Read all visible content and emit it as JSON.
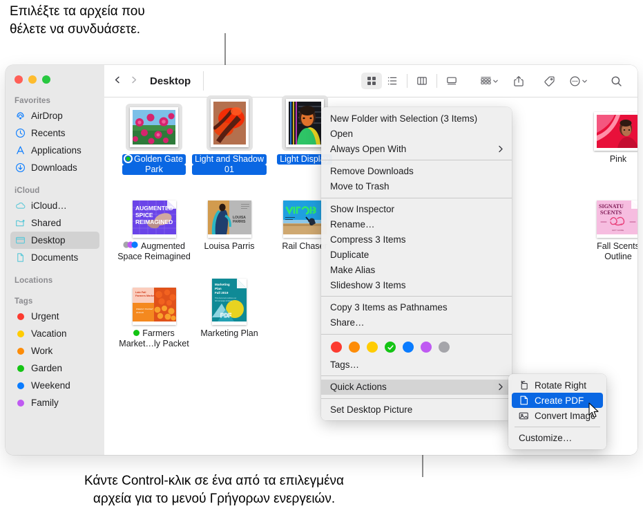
{
  "captions": {
    "top": "Επιλέξτε τα αρχεία που\nθέλετε να συνδυάσετε.",
    "bottom": "Κάντε Control-κλικ σε ένα από τα επιλεγμένα\nαρχεία για το μενού Γρήγορων ενεργειών."
  },
  "window": {
    "traffic_lights": [
      {
        "name": "close",
        "color": "#ff5f57"
      },
      {
        "name": "minimize",
        "color": "#febc2e"
      },
      {
        "name": "zoom",
        "color": "#28c840"
      }
    ]
  },
  "toolbar": {
    "back_icon": "chevron-left-icon",
    "forward_icon": "chevron-right-icon",
    "title": "Desktop",
    "views": [
      {
        "name": "icon-view",
        "icon": "grid-icon",
        "active": true
      },
      {
        "name": "list-view",
        "icon": "list-icon",
        "active": false
      },
      {
        "name": "column-view",
        "icon": "columns-icon",
        "active": false
      },
      {
        "name": "gallery-view",
        "icon": "gallery-icon",
        "active": false
      }
    ],
    "group_by_label": "group-icon",
    "share_label": "share-icon",
    "tag_label": "tag-icon",
    "more_label": "more-icon",
    "search_label": "search-icon"
  },
  "sidebar": {
    "sections": [
      {
        "header": "Favorites",
        "items": [
          {
            "label": "AirDrop",
            "icon": "airdrop-icon",
            "selected": false
          },
          {
            "label": "Recents",
            "icon": "clock-icon",
            "selected": false
          },
          {
            "label": "Applications",
            "icon": "applications-icon",
            "selected": false
          },
          {
            "label": "Downloads",
            "icon": "downloads-icon",
            "selected": false
          }
        ]
      },
      {
        "header": "iCloud",
        "items": [
          {
            "label": "iCloud…",
            "icon": "cloud-icon",
            "selected": false
          },
          {
            "label": "Shared",
            "icon": "shared-folder-icon",
            "selected": false
          },
          {
            "label": "Desktop",
            "icon": "desktop-icon",
            "selected": true
          },
          {
            "label": "Documents",
            "icon": "document-icon",
            "selected": false
          }
        ]
      },
      {
        "header": "Locations",
        "items": []
      },
      {
        "header": "Tags",
        "items": [
          {
            "label": "Urgent",
            "icon": "tag-dot",
            "color": "#fc3b30",
            "selected": false
          },
          {
            "label": "Vacation",
            "icon": "tag-dot",
            "color": "#ffcc02",
            "selected": false
          },
          {
            "label": "Work",
            "icon": "tag-dot",
            "color": "#fd8c08",
            "selected": false
          },
          {
            "label": "Garden",
            "icon": "tag-dot",
            "color": "#14c414",
            "selected": false
          },
          {
            "label": "Weekend",
            "icon": "tag-dot",
            "color": "#0a7cff",
            "selected": false
          },
          {
            "label": "Family",
            "icon": "tag-dot",
            "color": "#bf5af2",
            "selected": false
          }
        ]
      }
    ]
  },
  "files": [
    {
      "name_lines": [
        "Golden Gate",
        "Park"
      ],
      "selected": true,
      "tag_color": "#14c414",
      "kind": "photo-flowers"
    },
    {
      "name_lines": [
        "Light and Shadow",
        "01"
      ],
      "selected": true,
      "tag_color": null,
      "kind": "photo-redhand"
    },
    {
      "name_lines": [
        "Light Display"
      ],
      "selected": true,
      "tag_color": null,
      "kind": "photo-portrait"
    },
    {
      "name_lines": [
        "Pink"
      ],
      "selected": false,
      "tag_color": null,
      "kind": "photo-pink"
    },
    {
      "name_lines": [
        "Augmented",
        "Space Reimagined"
      ],
      "selected": false,
      "tag_color": "multi",
      "kind": "doc-augmented"
    },
    {
      "name_lines": [
        "Louisa Parris"
      ],
      "selected": false,
      "tag_color": null,
      "kind": "doc-louisa"
    },
    {
      "name_lines": [
        "Rail Chaser"
      ],
      "selected": false,
      "tag_color": null,
      "kind": "doc-rail"
    },
    {
      "name_lines": [
        "Fall Scents",
        "Outline"
      ],
      "selected": false,
      "tag_color": null,
      "kind": "doc-scents"
    },
    {
      "name_lines": [
        "Farmers",
        "Market…ly Packet"
      ],
      "selected": false,
      "tag_color": "#14c414",
      "kind": "doc-farmers"
    },
    {
      "name_lines": [
        "Marketing Plan"
      ],
      "selected": false,
      "tag_color": null,
      "kind": "doc-marketing"
    }
  ],
  "context_menu": {
    "groups": [
      [
        {
          "label": "New Folder with Selection (3 Items)",
          "submenu": false,
          "highlight": false
        },
        {
          "label": "Open",
          "submenu": false,
          "highlight": false
        },
        {
          "label": "Always Open With",
          "submenu": true,
          "highlight": false
        }
      ],
      [
        {
          "label": "Remove Downloads",
          "submenu": false,
          "highlight": false
        },
        {
          "label": "Move to Trash",
          "submenu": false,
          "highlight": false
        }
      ],
      [
        {
          "label": "Show Inspector",
          "submenu": false,
          "highlight": false
        },
        {
          "label": "Rename…",
          "submenu": false,
          "highlight": false
        },
        {
          "label": "Compress 3 Items",
          "submenu": false,
          "highlight": false
        },
        {
          "label": "Duplicate",
          "submenu": false,
          "highlight": false
        },
        {
          "label": "Make Alias",
          "submenu": false,
          "highlight": false
        },
        {
          "label": "Slideshow 3 Items",
          "submenu": false,
          "highlight": false
        }
      ],
      [
        {
          "label": "Copy 3 Items as Pathnames",
          "submenu": false,
          "highlight": false
        },
        {
          "label": "Share…",
          "submenu": false,
          "highlight": false
        }
      ]
    ],
    "tag_swatches": [
      {
        "name": "red",
        "color": "#fc3b30",
        "checked": false
      },
      {
        "name": "orange",
        "color": "#fd8c08",
        "checked": false
      },
      {
        "name": "yellow",
        "color": "#ffcc02",
        "checked": false
      },
      {
        "name": "green",
        "color": "#14c414",
        "checked": true
      },
      {
        "name": "blue",
        "color": "#0a7cff",
        "checked": false
      },
      {
        "name": "purple",
        "color": "#bf5af2",
        "checked": false
      },
      {
        "name": "gray",
        "color": "#a5a5aa",
        "checked": false
      }
    ],
    "tags_label": "Tags…",
    "quick_actions_label": "Quick Actions",
    "set_desktop_picture_label": "Set Desktop Picture"
  },
  "submenu": {
    "items": [
      {
        "label": "Rotate Right",
        "icon": "rotate-right-icon",
        "highlight": false
      },
      {
        "label": "Create PDF",
        "icon": "pdf-icon",
        "highlight": true
      },
      {
        "label": "Convert Image",
        "icon": "convert-image-icon",
        "highlight": false
      }
    ],
    "customize_label": "Customize…"
  }
}
